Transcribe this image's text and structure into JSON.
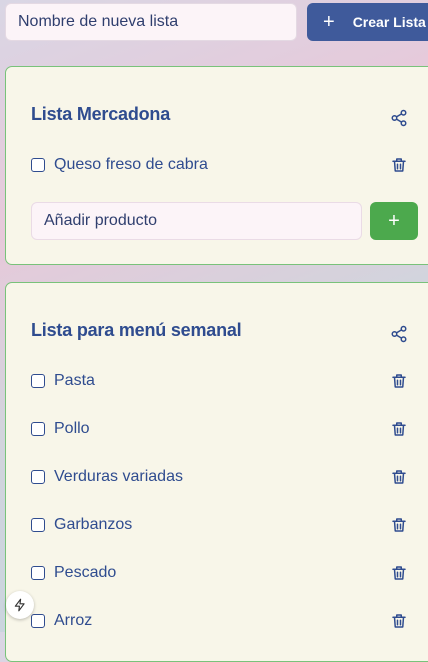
{
  "header": {
    "new_list_placeholder": "Nombre de nueva lista",
    "create_button_label": "Crear Lista"
  },
  "lists": [
    {
      "title": "Lista Mercadona",
      "items": [
        {
          "label": "Queso freso de cabra",
          "checked": false
        }
      ],
      "add_placeholder": "Añadir producto",
      "add_button": "+"
    },
    {
      "title": "Lista para menú semanal",
      "items": [
        {
          "label": "Pasta",
          "checked": false
        },
        {
          "label": "Pollo",
          "checked": false
        },
        {
          "label": "Verduras variadas",
          "checked": false
        },
        {
          "label": "Garbanzos",
          "checked": false
        },
        {
          "label": "Pescado",
          "checked": false
        },
        {
          "label": "Arroz",
          "checked": false
        }
      ]
    }
  ],
  "colors": {
    "primary": "#3f5a9b",
    "add_green": "#4ca94d",
    "card_border": "#79c27a",
    "card_bg": "#f8f6e9",
    "text": "#2f4c8f"
  },
  "icons": [
    "plus-icon",
    "share-icon",
    "trash-icon",
    "bolt-icon"
  ]
}
